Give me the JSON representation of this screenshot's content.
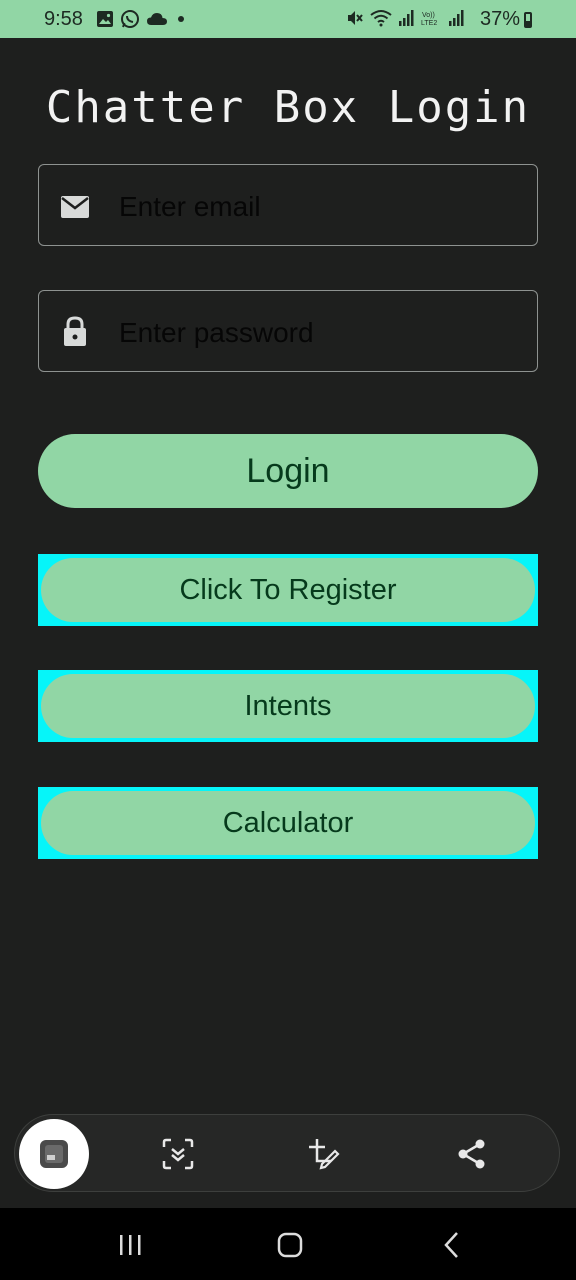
{
  "status_bar": {
    "time": "9:58",
    "battery": "37%",
    "left_icons": [
      "gallery-icon",
      "whatsapp-icon",
      "cloud-icon",
      "dot-icon"
    ],
    "right_icons": [
      "mute-icon",
      "wifi-icon",
      "signal-icon",
      "volte-icon",
      "signal-icon",
      "battery-icon"
    ]
  },
  "app": {
    "title": "Chatter Box Login",
    "email_placeholder": "Enter email",
    "password_placeholder": "Enter password",
    "login_label": "Login",
    "register_label": "Click To Register",
    "intents_label": "Intents",
    "calculator_label": "Calculator"
  },
  "colors": {
    "background": "#1e1f1e",
    "accent_green": "#91d6a5",
    "button_text": "#063a1c",
    "outline_cyan": "#06f5f9"
  },
  "screenshot_toolbar": {
    "items": [
      "thumbnail",
      "scan-icon",
      "edit-crop-icon",
      "share-icon"
    ]
  },
  "nav_bar": {
    "items": [
      "recents-icon",
      "home-icon",
      "back-icon"
    ]
  }
}
